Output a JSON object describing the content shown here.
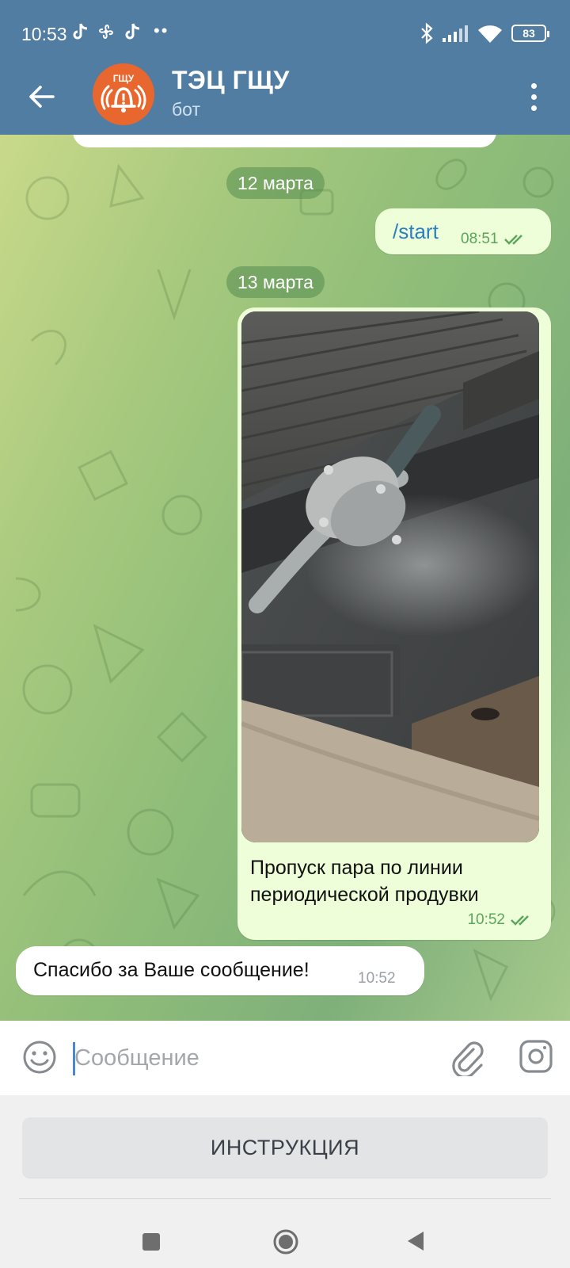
{
  "status_bar": {
    "time": "10:53",
    "dots": "••",
    "battery": "83",
    "icons": [
      "tiktok-icon",
      "fan-icon",
      "tiktok-icon",
      "bluetooth-icon",
      "signal-icon",
      "wifi-icon",
      "battery-icon"
    ]
  },
  "header": {
    "avatar_label": "ГЩУ",
    "title": "ТЭЦ ГЩУ",
    "subtitle": "бот",
    "colors": {
      "bar": "#517da2",
      "avatar": "#e8672e"
    }
  },
  "messages": {
    "date1": "12 марта",
    "start_command": "/start",
    "start_time": "08:51",
    "date2": "13 марта",
    "photo_caption": "Пропуск пара по линии периодической продувки",
    "photo_time": "10:52",
    "thanks_text": "Спасибо за Ваше сообщение!",
    "thanks_time": "10:52",
    "colors": {
      "outgoing": "#eefed8",
      "time_green": "#5ba45c",
      "link": "#2b7ec2"
    }
  },
  "composer": {
    "placeholder": "Сообщение",
    "value": ""
  },
  "bot_keyboard": {
    "button": "ИНСТРУКЦИЯ"
  }
}
